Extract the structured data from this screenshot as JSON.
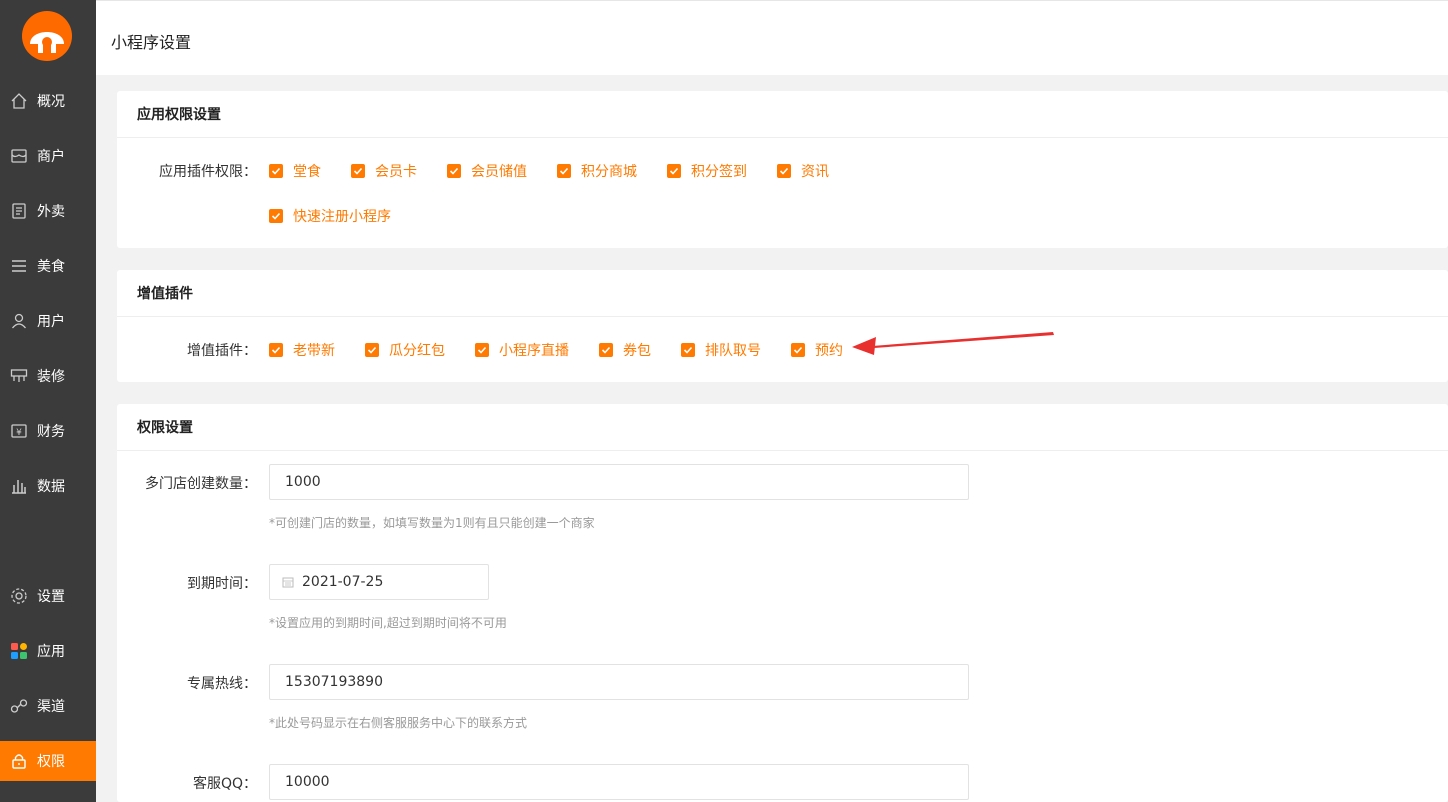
{
  "header": {
    "title": "小程序设置"
  },
  "sidebar": {
    "items": [
      {
        "label": "概况",
        "icon": "home-icon"
      },
      {
        "label": "商户",
        "icon": "store-icon"
      },
      {
        "label": "外卖",
        "icon": "document-icon"
      },
      {
        "label": "美食",
        "icon": "menu-icon"
      },
      {
        "label": "用户",
        "icon": "user-icon"
      },
      {
        "label": "装修",
        "icon": "decorate-icon"
      },
      {
        "label": "财务",
        "icon": "finance-icon"
      },
      {
        "label": "数据",
        "icon": "chart-icon"
      },
      {
        "label": "设置",
        "icon": "gear-icon"
      },
      {
        "label": "应用",
        "icon": "apps-icon"
      },
      {
        "label": "渠道",
        "icon": "link-icon"
      },
      {
        "label": "权限",
        "icon": "lock-icon",
        "active": true
      }
    ]
  },
  "app_permissions": {
    "title": "应用权限设置",
    "label": "应用插件权限：",
    "options": [
      "堂食",
      "会员卡",
      "会员储值",
      "积分商城",
      "积分签到",
      "资讯",
      "快速注册小程序"
    ]
  },
  "addons": {
    "title": "增值插件",
    "label": "增值插件：",
    "options": [
      "老带新",
      "瓜分红包",
      "小程序直播",
      "券包",
      "排队取号",
      "预约"
    ]
  },
  "permissions": {
    "title": "权限设置",
    "store_count": {
      "label": "多门店创建数量：",
      "value": "1000",
      "hint": "*可创建门店的数量，如填写数量为1则有且只能创建一个商家"
    },
    "expire": {
      "label": "到期时间：",
      "value": "2021-07-25",
      "hint": "*设置应用的到期时间,超过到期时间将不可用"
    },
    "hotline": {
      "label": "专属热线：",
      "value": "15307193890",
      "hint": "*此处号码显示在右侧客服服务中心下的联系方式"
    },
    "qq": {
      "label": "客服QQ：",
      "value": "10000"
    }
  },
  "colors": {
    "accent": "#ff7a00",
    "sidebar": "#3b3b3b",
    "arrow": "#e8302f"
  }
}
